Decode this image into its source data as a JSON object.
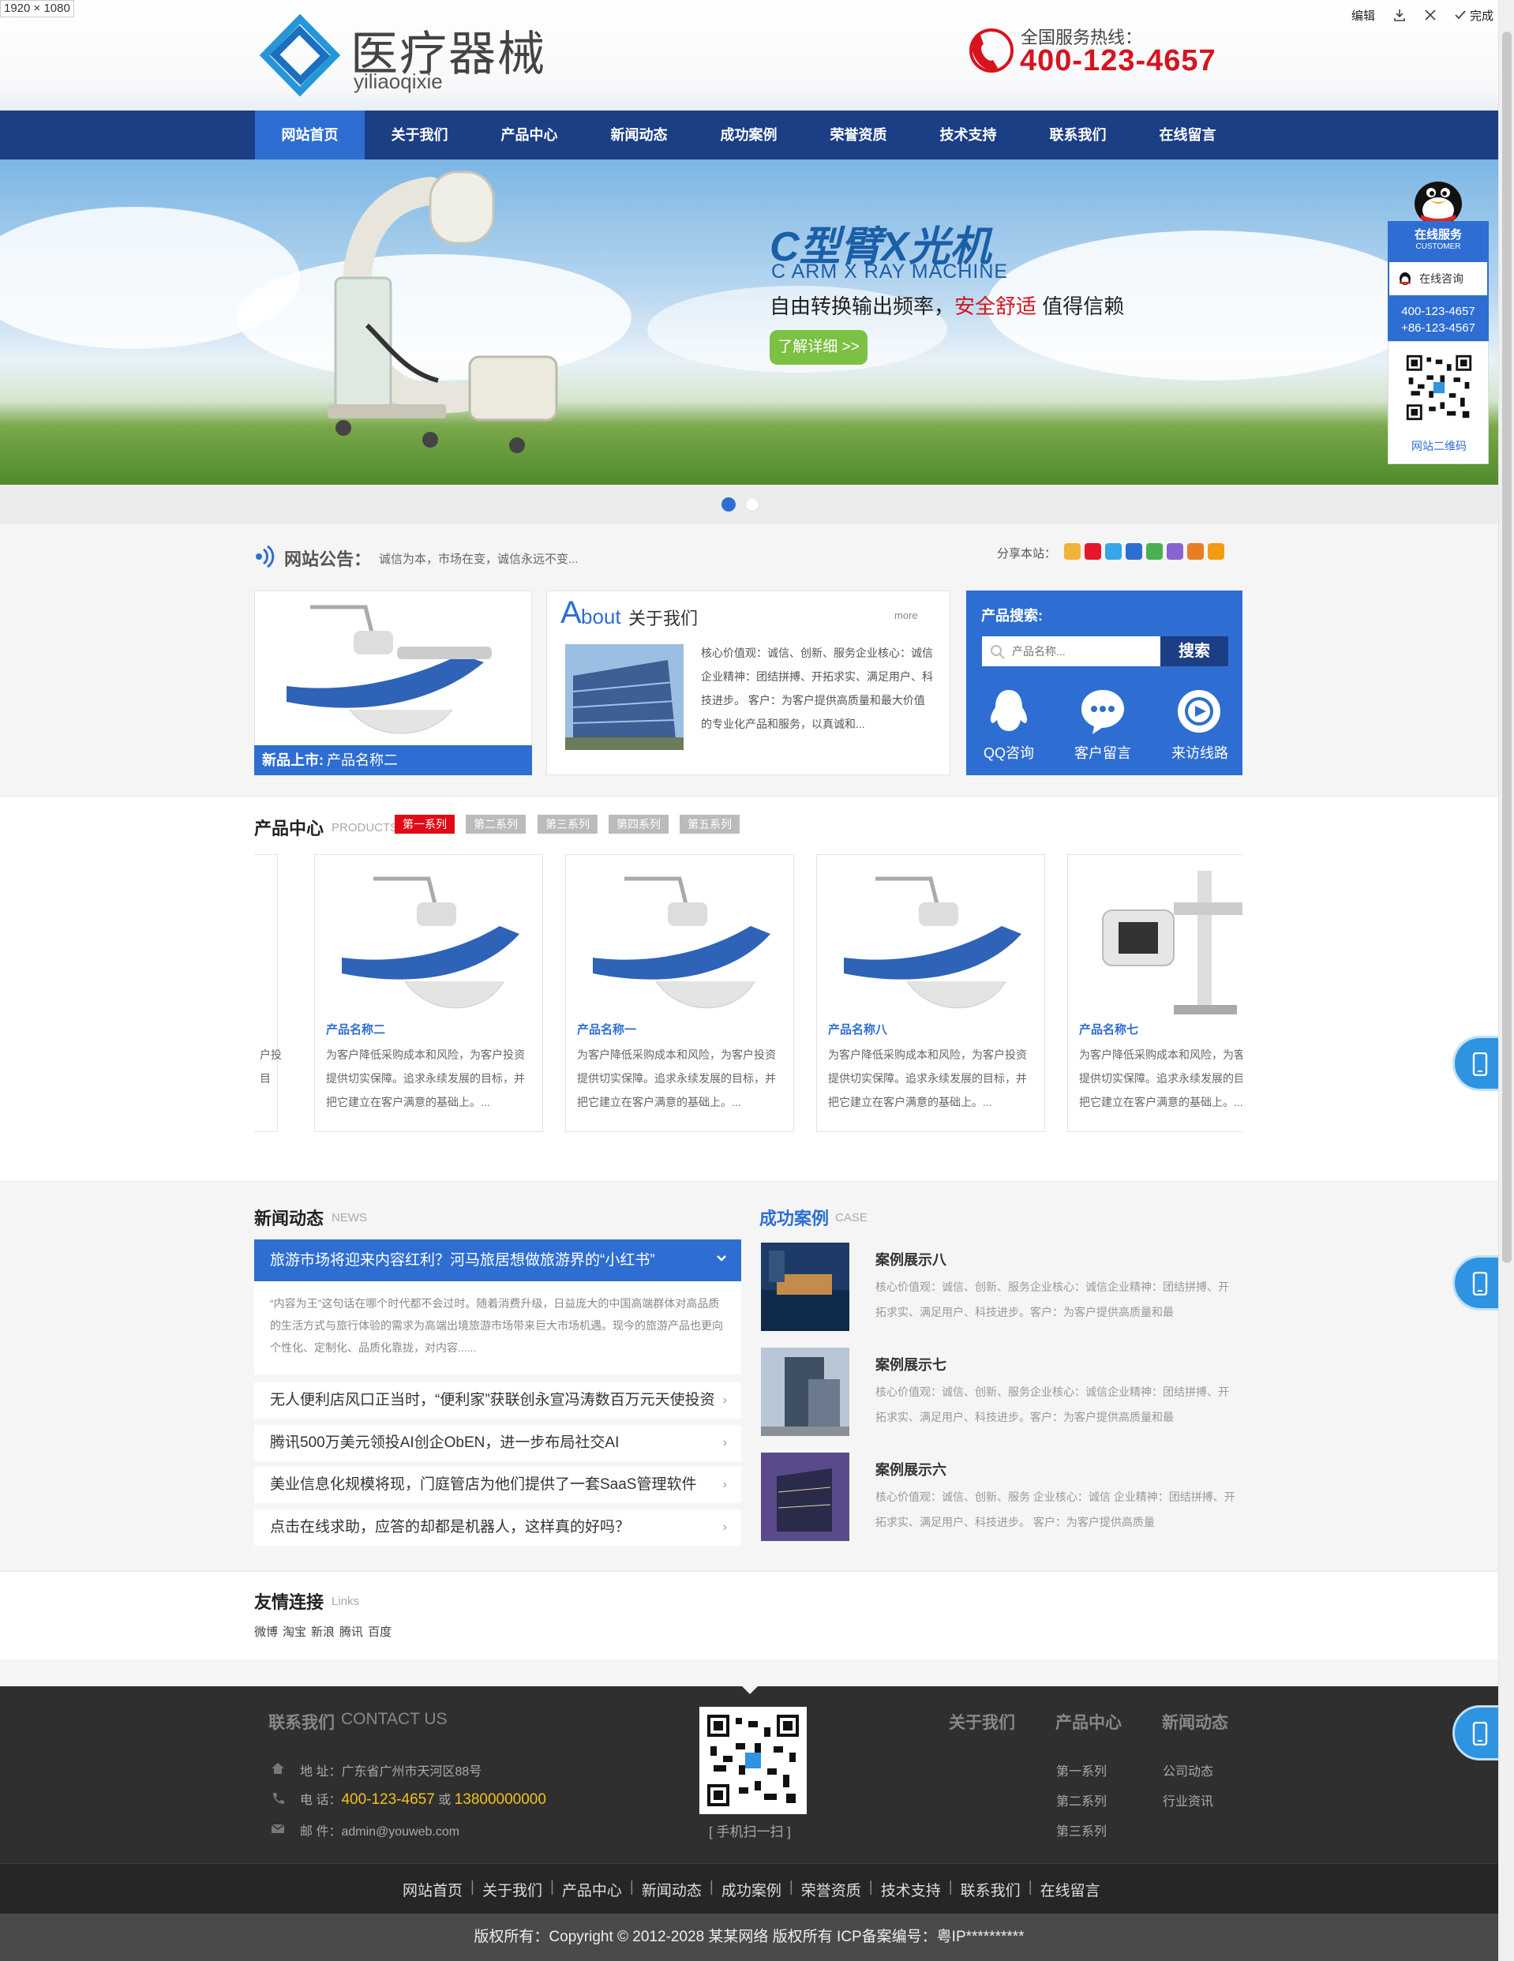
{
  "viewer": {
    "dimensions": "1920 × 1080",
    "edit": "编辑",
    "done": "完成"
  },
  "header": {
    "logo_cn": "医疗器械",
    "logo_en": "yiliaoqixie",
    "hotline_label": "全国服务热线：",
    "hotline_number": "400-123-4657"
  },
  "nav": {
    "items": [
      "网站首页",
      "关于我们",
      "产品中心",
      "新闻动态",
      "成功案例",
      "荣誉资质",
      "技术支持",
      "联系我们",
      "在线留言"
    ],
    "active_index": 0
  },
  "banner": {
    "title": "C型臂X光机",
    "subtitle": "C ARM X RAY MACHINE",
    "line_before": "自由转换输出频率，",
    "line_highlight": "安全舒适",
    "line_after": " 值得信赖",
    "button": "了解详细 >>",
    "slides": 2,
    "active_slide": 0
  },
  "notice": {
    "title": "网站公告：",
    "text": "诚信为本，市场在变，诚信永远不变...",
    "share_label": "分享本站："
  },
  "new_product": {
    "label": "新品上市:",
    "name": "产品名称二"
  },
  "about": {
    "title_a": "A",
    "title_rest": "bout",
    "title_cn": "关于我们",
    "more": "more",
    "text": "核心价值观：诚信、创新、服务企业核心：诚信 企业精神：团结拼搏、开拓求实、满足用户、科技进步。 客户：为客户提供高质量和最大价值的专业化产品和服务，以真诚和..."
  },
  "search": {
    "title": "产品搜索:",
    "placeholder": "产品名称...",
    "button": "搜索",
    "quick_links": [
      "QQ咨询",
      "客户留言",
      "来访线路"
    ]
  },
  "products": {
    "title": "产品中心",
    "title_en": "PRODUCTS",
    "tabs": [
      "第一系列",
      "第二系列",
      "第三系列",
      "第四系列",
      "第五系列"
    ],
    "active_tab": 0,
    "partial_left_desc": "户投\n目",
    "items": [
      {
        "name": "产品名称二",
        "desc": "为客户降低采购成本和风险，为客户投资提供切实保障。追求永续发展的目标，并把它建立在客户满意的基础上。..."
      },
      {
        "name": "产品名称一",
        "desc": "为客户降低采购成本和风险，为客户投资提供切实保障。追求永续发展的目标，并把它建立在客户满意的基础上。..."
      },
      {
        "name": "产品名称八",
        "desc": "为客户降低采购成本和风险，为客户投资提供切实保障。追求永续发展的目标，并把它建立在客户满意的基础上。..."
      },
      {
        "name": "产品名称七",
        "desc": "为客户降低采购成本和风险，为客户投资提供切实保障。追求永续发展的目标，并把它建立在客户满意的基础上。..."
      }
    ]
  },
  "news": {
    "title": "新闻动态",
    "title_en": "NEWS",
    "featured_title": "旅游市场将迎来内容红利？河马旅居想做旅游界的“小红书”",
    "featured_lead": "“内容为王”这句话在哪个时代都不会过时。随着消费升级，日益庞大的中国高端群体对高品质的生活方式与旅行体验的需求为高端出境旅游市场带来巨大市场机遇。现今的旅游产品也更向个性化、定制化、品质化靠拢，对内容......",
    "items": [
      "无人便利店风口正当时，“便利家”获联创永宣冯涛数百万元天使投资",
      "腾讯500万美元领投AI创企ObEN，进一步布局社交AI",
      "美业信息化规模将现，门庭管店为他们提供了一套SaaS管理软件",
      "点击在线求助，应答的却都是机器人，这样真的好吗？"
    ]
  },
  "cases": {
    "title": "成功案例",
    "title_en": "CASE",
    "items": [
      {
        "title": "案例展示八",
        "desc": "核心价值观：诚信、创新、服务企业核心：诚信企业精神：团结拼搏、开拓求实、满足用户、科技进步。客户：为客户提供高质量和最"
      },
      {
        "title": "案例展示七",
        "desc": "核心价值观：诚信、创新、服务企业核心：诚信企业精神：团结拼搏、开拓求实、满足用户、科技进步。客户：为客户提供高质量和最"
      },
      {
        "title": "案例展示六",
        "desc": "核心价值观：诚信、创新、服务 企业核心：诚信 企业精神：团结拼搏、开拓求实、满足用户、科技进步。 客户：为客户提供高质量"
      }
    ]
  },
  "links": {
    "title": "友情连接",
    "title_en": "Links",
    "items": [
      "微博",
      "淘宝",
      "新浪",
      "腾讯",
      "百度"
    ]
  },
  "footer": {
    "contact_title": "联系我们",
    "contact_en": "CONTACT US",
    "address_label": "地 址：",
    "address": "广东省广州市天河区88号",
    "phone_label": "电 话：",
    "phone1": "400-123-4657",
    "phone_or": " 或 ",
    "phone2": "13800000000",
    "email_label": "邮 件：",
    "email": "admin@youweb.com",
    "qr_caption": "[ 手机扫一扫 ]",
    "col1_title": "关于我们",
    "col2_title": "产品中心",
    "col2_items": [
      "第一系列",
      "第二系列",
      "第三系列"
    ],
    "col3_title": "新闻动态",
    "col3_items": [
      "公司动态",
      "行业资讯"
    ],
    "nav_items": [
      "网站首页",
      "关于我们",
      "产品中心",
      "新闻动态",
      "成功案例",
      "荣誉资质",
      "技术支持",
      "联系我们",
      "在线留言"
    ],
    "copyright": "版权所有：Copyright © 2012-2028 某某网络 版权所有 ICP备案编号：粤IP**********"
  },
  "float_service": {
    "title": "在线服务",
    "title_en": "CUSTOMER",
    "consult": "在线咨询",
    "phone1": "400-123-4657",
    "phone2": "+86-123-4567",
    "qr_caption": "网站二维码"
  },
  "colors": {
    "nav_bg": "#1b3e84",
    "accent": "#2e6ed2",
    "hotline": "#d7141e",
    "tab_active": "#e10b17",
    "footer_bg": "#2f2f2f"
  }
}
